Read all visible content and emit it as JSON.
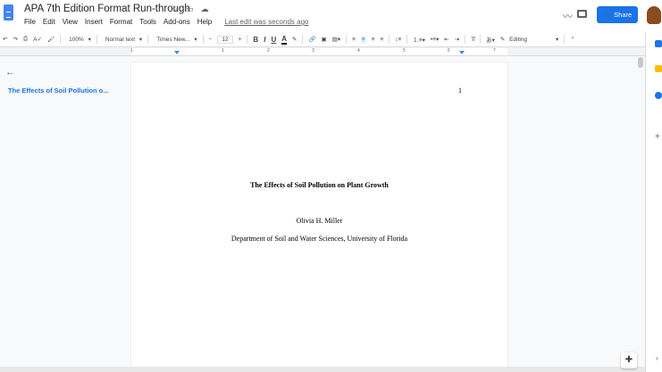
{
  "header": {
    "title": "APA 7th Edition Format Run-through",
    "last_edit": "Last edit was seconds ago",
    "share": "Share",
    "menu": [
      "File",
      "Edit",
      "View",
      "Insert",
      "Format",
      "Tools",
      "Add-ons",
      "Help"
    ]
  },
  "toolbar": {
    "zoom": "100%",
    "style": "Normal text",
    "font": "Times New...",
    "size": "12",
    "minus": "−",
    "plus": "+",
    "bold": "B",
    "italic": "I",
    "underline": "U",
    "color": "A",
    "mode": "Editing"
  },
  "ruler": [
    "1",
    "1",
    "2",
    "3",
    "4",
    "5",
    "6",
    "7"
  ],
  "outline": {
    "item": "The Effects of Soil Pollution o..."
  },
  "document": {
    "page_number": "1",
    "title": "The Effects of Soil Pollution on Plant Growth",
    "author": "Olivia H. Miller",
    "affiliation": "Department of Soil and Water Sciences, University of Florida"
  }
}
